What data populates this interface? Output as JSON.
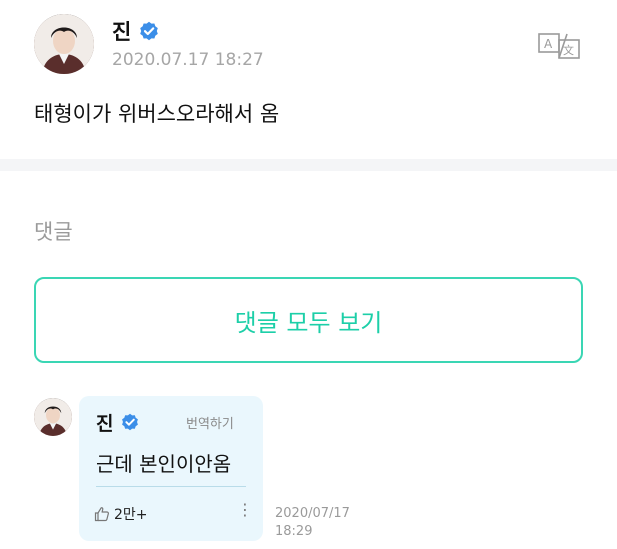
{
  "post": {
    "author": "진",
    "timestamp": "2020.07.17 18:27",
    "body": "태형이가 위버스오라해서 옴",
    "translate_icon": "translate-icon",
    "verified_icon": "verified-badge-icon"
  },
  "comments_section": {
    "heading": "댓글",
    "view_all_label": "댓글 모두 보기"
  },
  "comment": {
    "author": "진",
    "translate_label": "번역하기",
    "body": "근데 본인이안옴",
    "likes": "2만+",
    "like_icon": "thumbs-up-icon",
    "more_icon": "more-vertical-icon",
    "time_date": "2020/07/17",
    "time_clock": "18:29"
  },
  "colors": {
    "accent": "#1dcfa8",
    "bubble": "#eaf7fd",
    "verified": "#3b8ee8",
    "muted": "#a6a6a6"
  }
}
